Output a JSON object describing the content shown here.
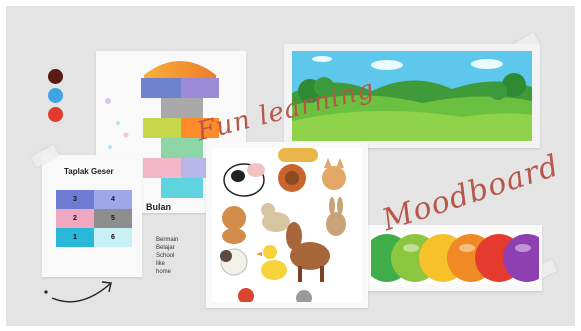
{
  "palette": {
    "swatches": [
      "#5c1a14",
      "#3fa3e6",
      "#e13b2e"
    ]
  },
  "taplak": {
    "title": "Taplak Geser",
    "cells": [
      {
        "label": "3",
        "color": "#6e7bd2"
      },
      {
        "label": "4",
        "color": "#9ea8e6"
      },
      {
        "label": "2",
        "color": "#f0a7c2"
      },
      {
        "label": "5",
        "color": "#8e8e8e"
      },
      {
        "label": "1",
        "color": "#29b8d8"
      },
      {
        "label": "6",
        "color": "#c8f0f5"
      }
    ]
  },
  "hopscotch": {
    "label": "Bulan"
  },
  "note": {
    "lines": [
      "Bermain",
      "Belajar",
      "School",
      "like",
      "home"
    ]
  },
  "titles": {
    "fun_learning": "Fun learning",
    "moodboard": "Moodboard"
  },
  "colors": {
    "accent_script": "#b7574a",
    "board_bg": "#e4e4e4"
  }
}
